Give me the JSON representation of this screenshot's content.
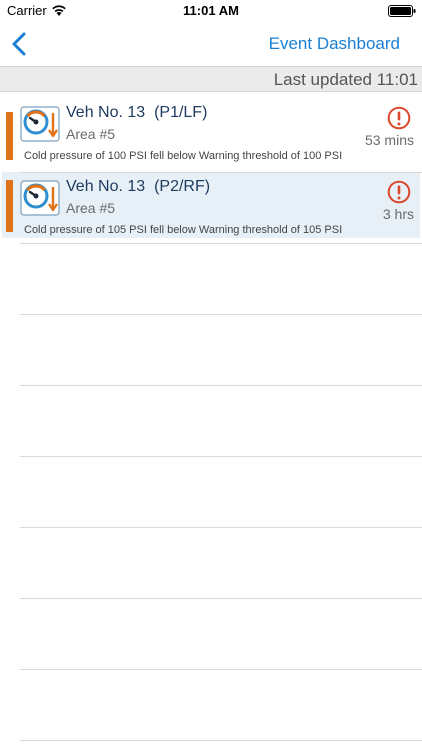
{
  "status_bar": {
    "carrier": "Carrier",
    "time": "11:01 AM"
  },
  "nav": {
    "title": "Event Dashboard"
  },
  "updated": {
    "text": "Last updated 11:01"
  },
  "events": [
    {
      "vehicle": "Veh No. 13",
      "position": "(P1/LF)",
      "area": "Area #5",
      "age": "53 mins",
      "description": "Cold pressure of 100 PSI fell below Warning threshold of 100 PSI",
      "selected": false
    },
    {
      "vehicle": "Veh No. 13",
      "position": "(P2/RF)",
      "area": "Area #5",
      "age": "3 hrs",
      "description": "Cold pressure of 105 PSI fell below Warning threshold of 105 PSI",
      "selected": true
    }
  ],
  "colors": {
    "accent_orange": "#e0721a",
    "alert_red": "#d9482b",
    "link_blue": "#1a7fd4",
    "selected_bg": "#e6f0f6"
  },
  "icons": {
    "back": "chevron-left-icon",
    "wifi": "wifi-icon",
    "battery": "battery-icon",
    "gauge": "pressure-gauge-icon",
    "alert": "exclamation-circle-icon"
  }
}
